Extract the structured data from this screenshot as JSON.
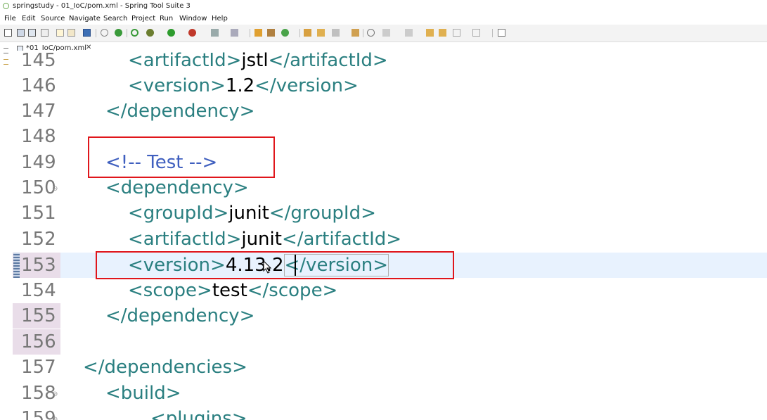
{
  "window": {
    "title": "springstudy - 01_IoC/pom.xml - Spring Tool Suite 3"
  },
  "menu": [
    "File",
    "Edit",
    "Source",
    "Navigate",
    "Search",
    "Project",
    "Run",
    "Window",
    "Help"
  ],
  "editor_tab": {
    "label": "*01_IoC/pom.xml",
    "close": "✕"
  },
  "lines": [
    {
      "num": "145",
      "open": "<artifactId>",
      "text": "jstl",
      "close": "</artifactId>"
    },
    {
      "num": "146",
      "open": "<version>",
      "text": "1.2",
      "close": "</version>"
    },
    {
      "num": "147",
      "open": "</dependency>"
    },
    {
      "num": "148"
    },
    {
      "num": "149",
      "comment": "<!-- Test -->"
    },
    {
      "num": "150",
      "open": "<dependency>",
      "fold": "⊖"
    },
    {
      "num": "151",
      "open": "<groupId>",
      "text": "junit",
      "close": "</groupId>"
    },
    {
      "num": "152",
      "open": "<artifactId>",
      "text": "junit",
      "close": "</artifactId>"
    },
    {
      "num": "153",
      "open": "<version>",
      "text": "4.13.2",
      "close": "</version>"
    },
    {
      "num": "154",
      "open": "<scope>",
      "text": "test",
      "close": "</scope>"
    },
    {
      "num": "155",
      "open": "</dependency>"
    },
    {
      "num": "156"
    },
    {
      "num": "157",
      "open": "</dependencies>"
    },
    {
      "num": "158",
      "open": "<build>",
      "fold": "⊖"
    },
    {
      "num": "159",
      "open": "<plugins>",
      "fold": "⊖"
    }
  ],
  "colors": {
    "tag": "#2a7f80",
    "comment": "#3f5fbf",
    "highlight_box": "#e0161b",
    "current_line": "#e8f2fe"
  },
  "icons": [
    "new-icon",
    "save-icon",
    "print-icon",
    "debug-icon",
    "run-icon",
    "external-tools-icon",
    "search-icon",
    "navigate-back-icon",
    "navigate-forward-icon",
    "perspective-icon"
  ]
}
